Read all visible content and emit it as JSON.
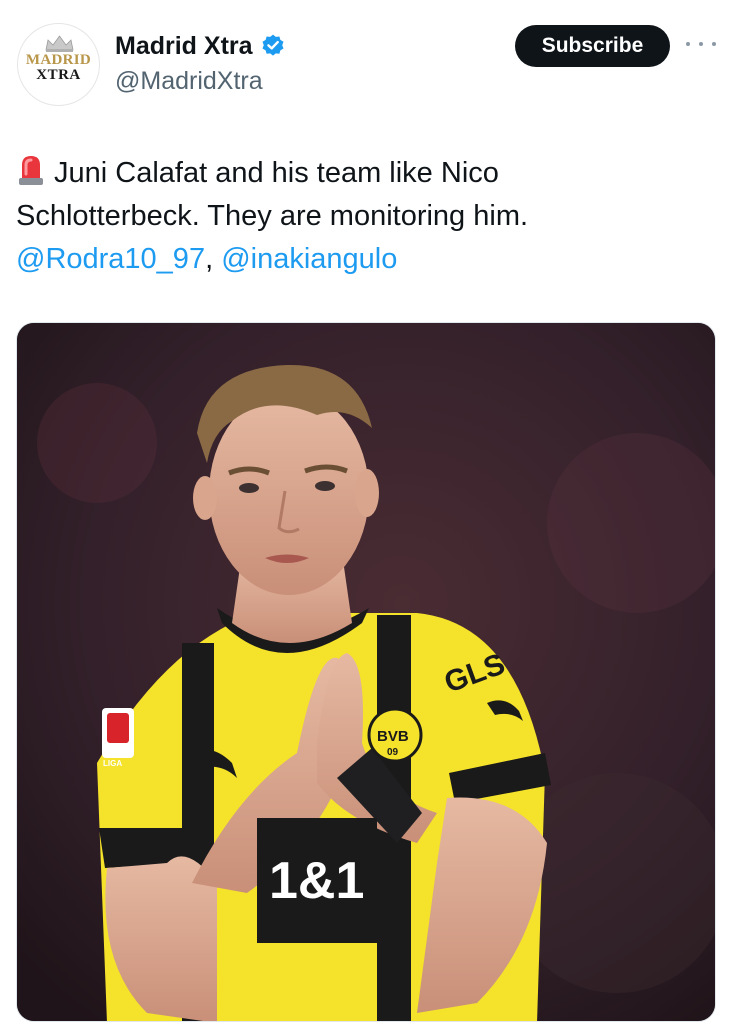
{
  "author": {
    "display_name": "Madrid Xtra",
    "handle": "@MadridXtra",
    "avatar_logo_lines": [
      "MADRID",
      "XTRA"
    ],
    "verified": true,
    "verified_color": "#1d9bf0"
  },
  "actions": {
    "subscribe_label": "Subscribe",
    "more_icon": "more-horizontal-icon"
  },
  "tweet": {
    "emoji": "police-light-siren-icon",
    "text_line_1": "Juni Calafat and his team like Nico",
    "text_line_2": "Schlotterbeck. They are monitoring him.",
    "mentions": [
      "@Rodra10_97",
      "@inakiangulo"
    ],
    "mention_separator": ", ",
    "mention_color": "#1d9bf0"
  },
  "media": {
    "description_icon": "photo-footballer-applauding",
    "jersey_text": {
      "sponsor": "1&1",
      "sleeve": "GLS",
      "crest": "BVB 09",
      "patch": "LIGA"
    },
    "colors": {
      "kit_yellow": "#f5e22a",
      "kit_black": "#1a1a1a",
      "background": "#3a2228"
    }
  }
}
